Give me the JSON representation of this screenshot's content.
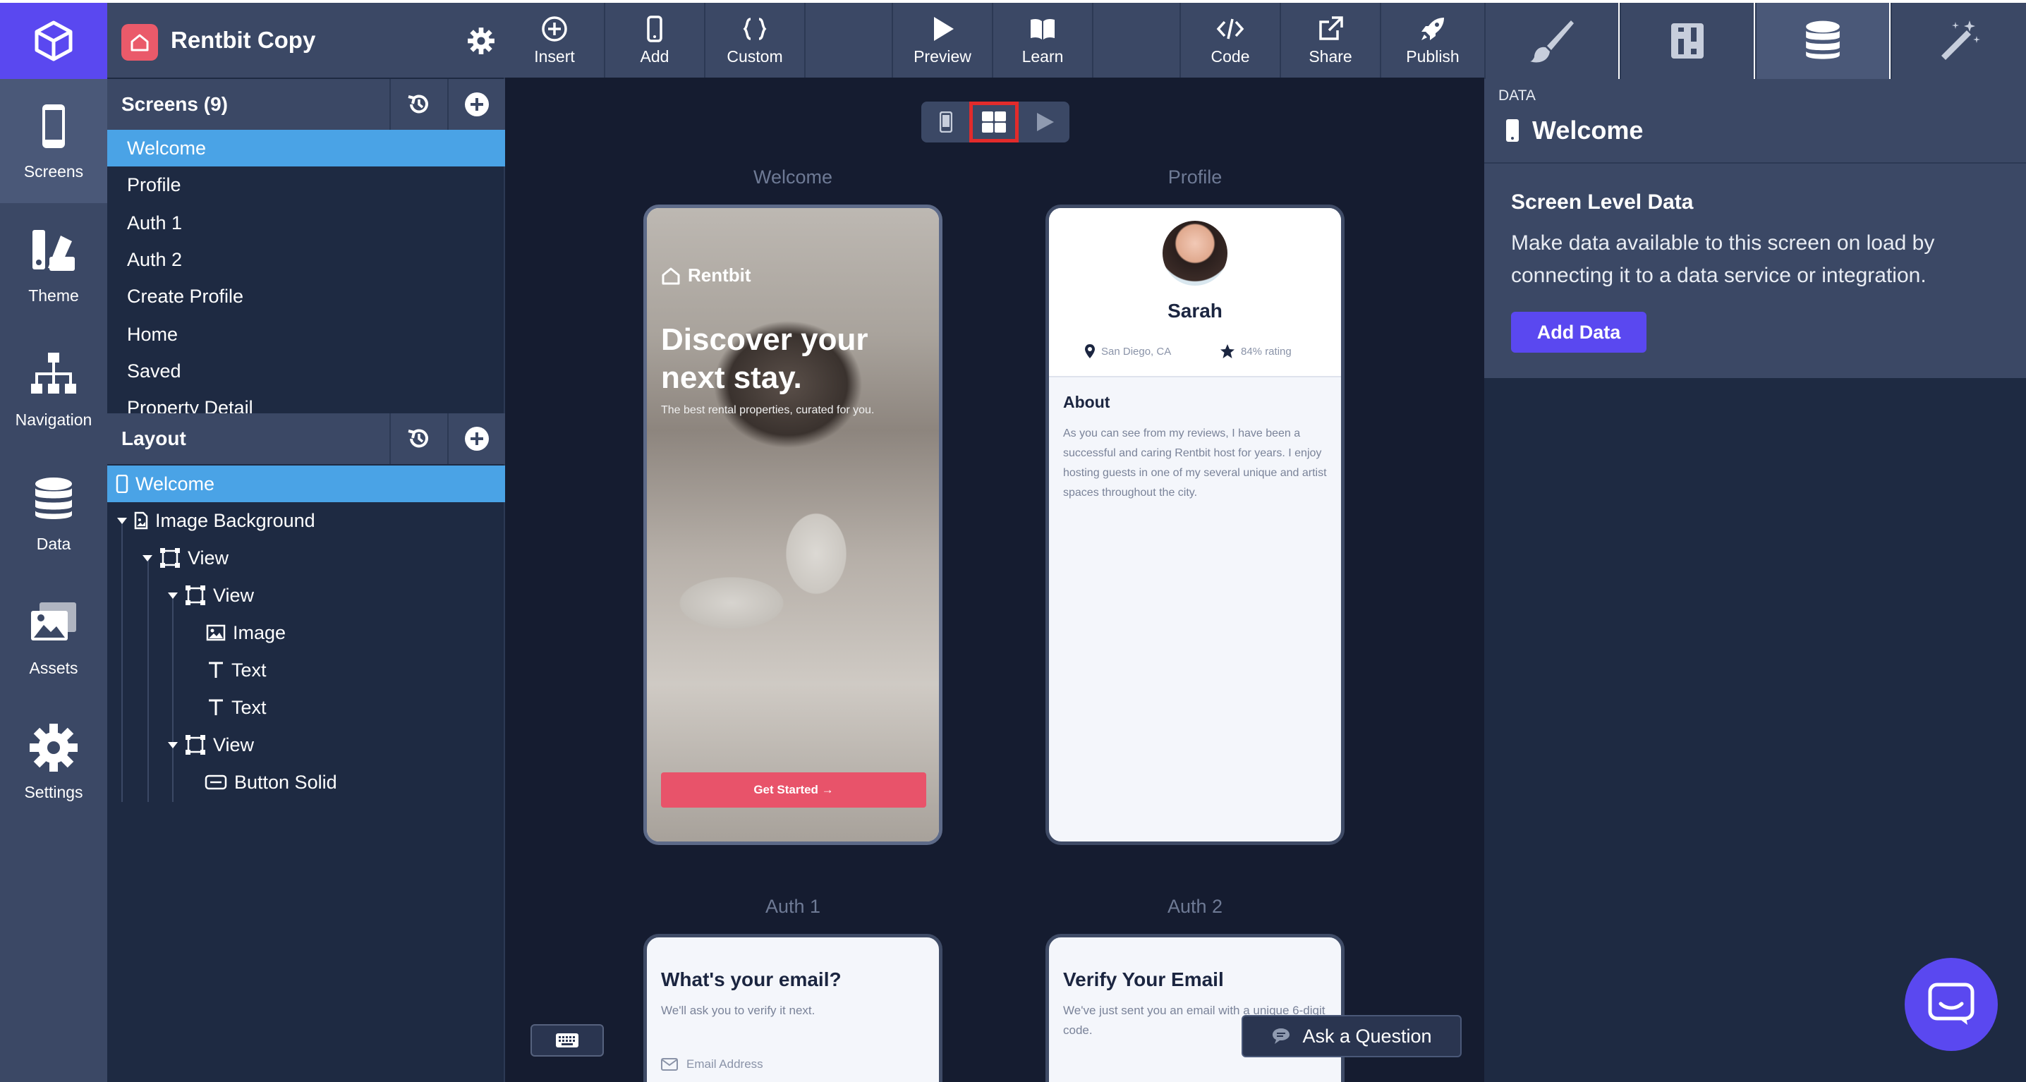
{
  "rail": {
    "items": [
      {
        "label": "Screens",
        "icon": "phone-icon"
      },
      {
        "label": "Theme",
        "icon": "palette-icon"
      },
      {
        "label": "Navigation",
        "icon": "sitemap-icon"
      },
      {
        "label": "Data",
        "icon": "database-icon"
      },
      {
        "label": "Assets",
        "icon": "images-icon"
      },
      {
        "label": "Settings",
        "icon": "gear-icon"
      }
    ]
  },
  "project": {
    "name": "Rentbit Copy"
  },
  "screens": {
    "title": "Screens (9)",
    "items": [
      "Welcome",
      "Profile",
      "Auth 1",
      "Auth 2",
      "Create Profile",
      "Home",
      "Saved",
      "Property Detail"
    ]
  },
  "layout": {
    "title": "Layout",
    "tree": [
      "Welcome",
      "Image Background",
      "View",
      "View",
      "Image",
      "Text",
      "Text",
      "View",
      "Button Solid"
    ]
  },
  "toolbar": {
    "insert": "Insert",
    "add": "Add",
    "custom": "Custom",
    "preview": "Preview",
    "learn": "Learn",
    "code": "Code",
    "share": "Share",
    "publish": "Publish"
  },
  "data_panel": {
    "section": "DATA",
    "screen": "Welcome",
    "heading": "Screen Level Data",
    "description": "Make data available to this screen on load by connecting it to a data service or integration.",
    "button": "Add Data"
  },
  "canvas": {
    "labels": [
      "Welcome",
      "Profile",
      "Auth 1",
      "Auth 2"
    ],
    "welcome": {
      "brand": "Rentbit",
      "title": "Discover your next stay.",
      "subtitle": "The best rental properties, curated for you.",
      "button": "Get Started →"
    },
    "profile": {
      "name": "Sarah",
      "location": "San Diego, CA",
      "rating": "84% rating",
      "about_title": "About",
      "about_text": "As you can see from my reviews, I have been a successful and caring Rentbit host for years. I enjoy hosting guests in one of my several unique and artist spaces throughout the city."
    },
    "auth1": {
      "title": "What's your email?",
      "subtitle": "We'll ask you to verify it next.",
      "field": "Email Address"
    },
    "auth2": {
      "title": "Verify Your Email",
      "subtitle": "We've just sent you an email with a unique 6-digit code."
    }
  },
  "help": {
    "ask": "Ask a Question"
  },
  "colors": {
    "accent": "#5a48f0",
    "selection": "#4aa3e6",
    "brand": "#ea5a6a",
    "panel": "#3b4865",
    "canvas": "#151c30"
  }
}
